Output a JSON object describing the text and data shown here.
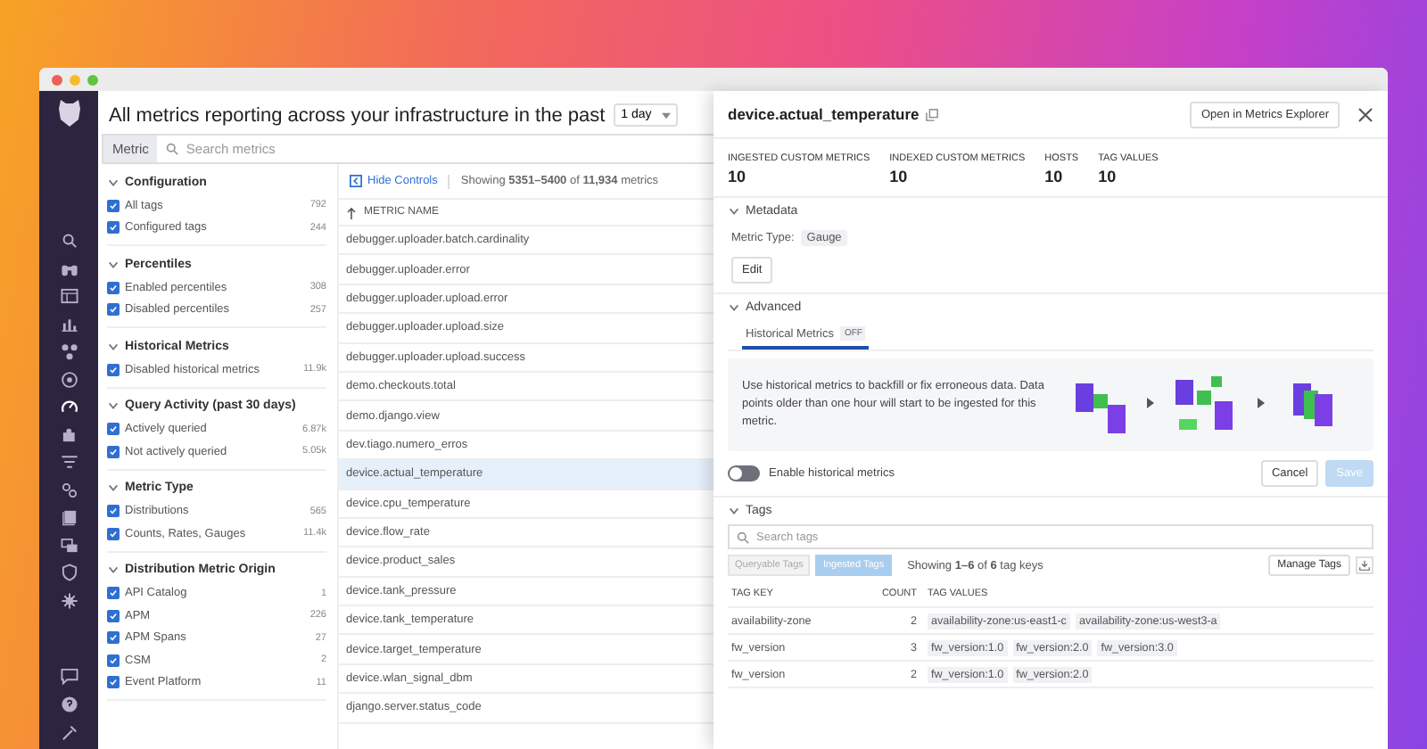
{
  "header": {
    "title": "All metrics reporting across your infrastructure in the past",
    "timeframe": "1 day"
  },
  "search": {
    "label": "Metric",
    "placeholder": "Search metrics"
  },
  "filters": [
    {
      "title": "Configuration",
      "expanded": true,
      "items": [
        {
          "label": "All tags",
          "count": "792",
          "checked": true
        },
        {
          "label": "Configured tags",
          "count": "244",
          "checked": true
        }
      ]
    },
    {
      "title": "Percentiles",
      "expanded": true,
      "items": [
        {
          "label": "Enabled percentiles",
          "count": "308",
          "checked": true
        },
        {
          "label": "Disabled percentiles",
          "count": "257",
          "checked": true
        }
      ]
    },
    {
      "title": "Historical Metrics",
      "expanded": true,
      "items": [
        {
          "label": "Disabled historical metrics",
          "count": "11.9k",
          "checked": true
        }
      ]
    },
    {
      "title": "Query Activity (past 30 days)",
      "expanded": true,
      "items": [
        {
          "label": "Actively queried",
          "count": "6.87k",
          "checked": true
        },
        {
          "label": "Not actively queried",
          "count": "5.05k",
          "checked": true
        }
      ]
    },
    {
      "title": "Metric Type",
      "expanded": true,
      "items": [
        {
          "label": "Distributions",
          "count": "565",
          "checked": true
        },
        {
          "label": "Counts, Rates, Gauges",
          "count": "11.4k",
          "checked": true
        }
      ]
    },
    {
      "title": "Distribution Metric Origin",
      "expanded": true,
      "items": [
        {
          "label": "API Catalog",
          "count": "1",
          "checked": true
        },
        {
          "label": "APM",
          "count": "226",
          "checked": true
        },
        {
          "label": "APM Spans",
          "count": "27",
          "checked": true
        },
        {
          "label": "CSM",
          "count": "2",
          "checked": true
        },
        {
          "label": "Event Platform",
          "count": "11",
          "checked": true
        }
      ]
    }
  ],
  "list": {
    "hide_controls": "Hide Controls",
    "showing": "Showing **5351–5400** of **11,934** metrics",
    "column": "METRIC NAME",
    "rows": [
      {
        "name": "debugger.uploader.batch.cardinality",
        "selected": false
      },
      {
        "name": "debugger.uploader.error",
        "selected": false
      },
      {
        "name": "debugger.uploader.upload.error",
        "selected": false
      },
      {
        "name": "debugger.uploader.upload.size",
        "selected": false
      },
      {
        "name": "debugger.uploader.upload.success",
        "selected": false
      },
      {
        "name": "demo.checkouts.total",
        "selected": false
      },
      {
        "name": "demo.django.view",
        "selected": false
      },
      {
        "name": "dev.tiago.numero_erros",
        "selected": false
      },
      {
        "name": "device.actual_temperature",
        "selected": true
      },
      {
        "name": "device.cpu_temperature",
        "selected": false
      },
      {
        "name": "device.flow_rate",
        "selected": false
      },
      {
        "name": "device.product_sales",
        "selected": false
      },
      {
        "name": "device.tank_pressure",
        "selected": false
      },
      {
        "name": "device.tank_temperature",
        "selected": false
      },
      {
        "name": "device.target_temperature",
        "selected": false
      },
      {
        "name": "device.wlan_signal_dbm",
        "selected": false
      },
      {
        "name": "django.server.status_code",
        "selected": false
      }
    ]
  },
  "detail": {
    "title": "device.actual_temperature",
    "open_button": "Open in Metrics Explorer",
    "stats": [
      {
        "label": "INGESTED CUSTOM METRICS",
        "value": "10"
      },
      {
        "label": "INDEXED CUSTOM METRICS",
        "value": "10"
      },
      {
        "label": "HOSTS",
        "value": "10"
      },
      {
        "label": "TAG VALUES",
        "value": "10"
      }
    ],
    "metadata": {
      "title": "Metadata",
      "expanded": true,
      "type_label": "Metric Type:",
      "type_value": "Gauge",
      "edit": "Edit"
    },
    "advanced": {
      "title": "Advanced",
      "expanded": true,
      "tabs": [
        {
          "label": "Historical Metrics",
          "badge": "OFF",
          "selected": true
        }
      ],
      "info": "Use historical metrics to backfill or fix erroneous data. Data points older than one hour will start to be ingested for this metric.",
      "toggle": {
        "label": "Enable historical metrics",
        "on": false
      },
      "cancel": "Cancel",
      "save": {
        "label": "Save",
        "disabled": true
      }
    },
    "tags": {
      "title": "Tags",
      "expanded": true,
      "placeholder": "Search tags",
      "tabs": [
        {
          "label": "Queryable Tags",
          "selected": false
        },
        {
          "label": "Ingested Tags",
          "selected": true
        }
      ],
      "showing": "Showing **1–6** of **6** tag keys",
      "manage": "Manage Tags",
      "columns": [
        "TAG KEY",
        "COUNT",
        "TAG VALUES"
      ],
      "rows": [
        {
          "key": "availability-zone",
          "count": "2",
          "values": [
            "availability-zone:us-east1-c",
            "availability-zone:us-west3-a"
          ]
        },
        {
          "key": "fw_version",
          "count": "3",
          "values": [
            "fw_version:1.0",
            "fw_version:2.0",
            "fw_version:3.0"
          ]
        },
        {
          "key": "fw_version",
          "count": "2",
          "values": [
            "fw_version:1.0",
            "fw_version:2.0"
          ]
        }
      ]
    }
  }
}
